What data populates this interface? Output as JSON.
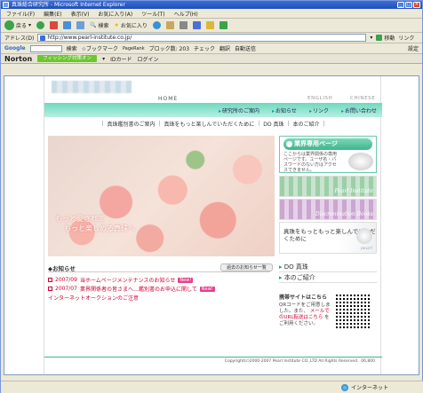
{
  "window": {
    "title": "真珠総合研究所 - Microsoft Internet Explorer"
  },
  "menu": [
    "ファイル(F)",
    "編集(E)",
    "表示(V)",
    "お気に入り(A)",
    "ツール(T)",
    "ヘルプ(H)"
  ],
  "toolbar": {
    "back": "戻る",
    "search": "検索",
    "favorites": "お気に入り"
  },
  "address": {
    "label": "アドレス(D)",
    "url": "http://www.pearl-institute.co.jp/",
    "go": "移動",
    "links": "リンク"
  },
  "googlebar": {
    "logo": "Google",
    "search_btn": "検索",
    "pagerank": "PageRank",
    "bookmarks": "ブックマーク",
    "blocked": "ブロック数: 203",
    "check": "チェック",
    "translate": "翻訳",
    "autofill": "自動送信",
    "settings": "設定"
  },
  "nortonbar": {
    "logo": "Norton",
    "phishing": "フィッシング対策オン",
    "id_card": "IDカード",
    "login": "ログイン"
  },
  "site": {
    "home": "HOME",
    "english": "ENGLISH",
    "chinese": "CHINESE",
    "green_nav": [
      "研究所のご案内",
      "お知らせ",
      "リンク",
      "お問い合わせ"
    ],
    "sub_nav": [
      "真珠鑑別書のご案内",
      "真珠をもっと楽しんでいただくために",
      "DO 真珠",
      "本のご紹介"
    ],
    "hero_copy_1": "もっと愛されて",
    "hero_copy_2": "もっと楽しめる真珠へ",
    "business": {
      "button": "業界専用ページ",
      "text": "ここからは業界関係の専用ページです。ユーザ名・パスワードのない方はアクセスできません。"
    },
    "banner1": "Pearl Institute",
    "banner2": "Discrimination Books",
    "banner3": {
      "text": "真珠をもっともっと楽しんでいただくために",
      "en": "pearl"
    },
    "news": {
      "heading": "◆お知らせ",
      "all_button": "過去のお知らせ一覧",
      "items": [
        {
          "date": "2007/09",
          "text": "当ホームページメンテナンスのお知らせ",
          "badge": "New!"
        },
        {
          "date": "2007/07",
          "text": "業界関係者の皆さまへ…鑑別書のお申込に関して",
          "badge": "New!"
        },
        {
          "date": "",
          "text": "インターネットオークションのご注意",
          "badge": ""
        }
      ]
    },
    "side_links": [
      "DO 真珠",
      "本のご紹介"
    ],
    "mobile": {
      "heading": "携帯サイトはこちら",
      "text": "QRコードをご用意しました。また、",
      "mail": "メールでのURL転送はこちら",
      "end": "をご利用ください。"
    },
    "copyright": "Copyright(c)2000-2007 Pearl Institute CO.,LTD All Rights Reserved.",
    "counter": "06,800"
  },
  "status": {
    "text": "",
    "zone": "インターネット"
  }
}
